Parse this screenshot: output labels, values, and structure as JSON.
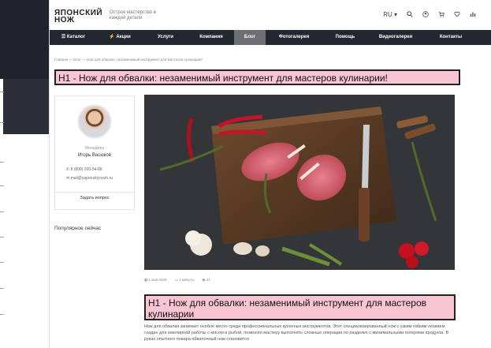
{
  "site": {
    "logo_line1": "ЯПОНСКИЙ",
    "logo_line2": "НОЖ",
    "tagline": "Острое мастерство в каждой детали",
    "lang": "RU",
    "icons": [
      "search-icon",
      "user-icon",
      "cart-icon",
      "heart-icon",
      "chart-icon"
    ]
  },
  "nav": {
    "items": [
      {
        "label": "Каталог"
      },
      {
        "label": "Акции"
      },
      {
        "label": "Услуги"
      },
      {
        "label": "Компания"
      },
      {
        "label": "Блог"
      },
      {
        "label": "Фотогалерея"
      },
      {
        "label": "Помощь"
      },
      {
        "label": "Видеогалерея"
      },
      {
        "label": "Контакты"
      }
    ],
    "active": "Блог"
  },
  "breadcrumb": "Главная  —  Блог  —  Нож для обвалки: незаменимый инструмент для мастеров кулинарии!",
  "h1": "H1 - Нож для обвалки: незаменимый инструмент для мастеров кулинарии!",
  "author": {
    "role": "Менеджер",
    "name": "Игорь Васюков",
    "phone": "8 (800) 200-54-88",
    "email": "mail@yaponskij-nozh.ru",
    "ask_label": "Задать вопрос"
  },
  "popular_label": "Популярное сейчас",
  "meta": {
    "date": "1 мая 2025",
    "read_time": "2 минуты",
    "views": "21"
  },
  "h2": "H1 - Нож для обвалки: незаменимый инструмент для мастеров кулинарии",
  "intro": "Нож для обвалки занимает особое место среди профессиональных кухонных инструментов. Этот специализированный нож с узким гибким лезвием создан для ювелирной работы с мясом и рыбой, позволяя мастеру выполнять сложные операции по разделке с минимальными потерями продукта. В руках опытного повара обвалочный нож становится",
  "colors": {
    "nav_bg": "#23272f",
    "nav_active": "#6d6f73",
    "highlight": "#f9c5d2"
  }
}
